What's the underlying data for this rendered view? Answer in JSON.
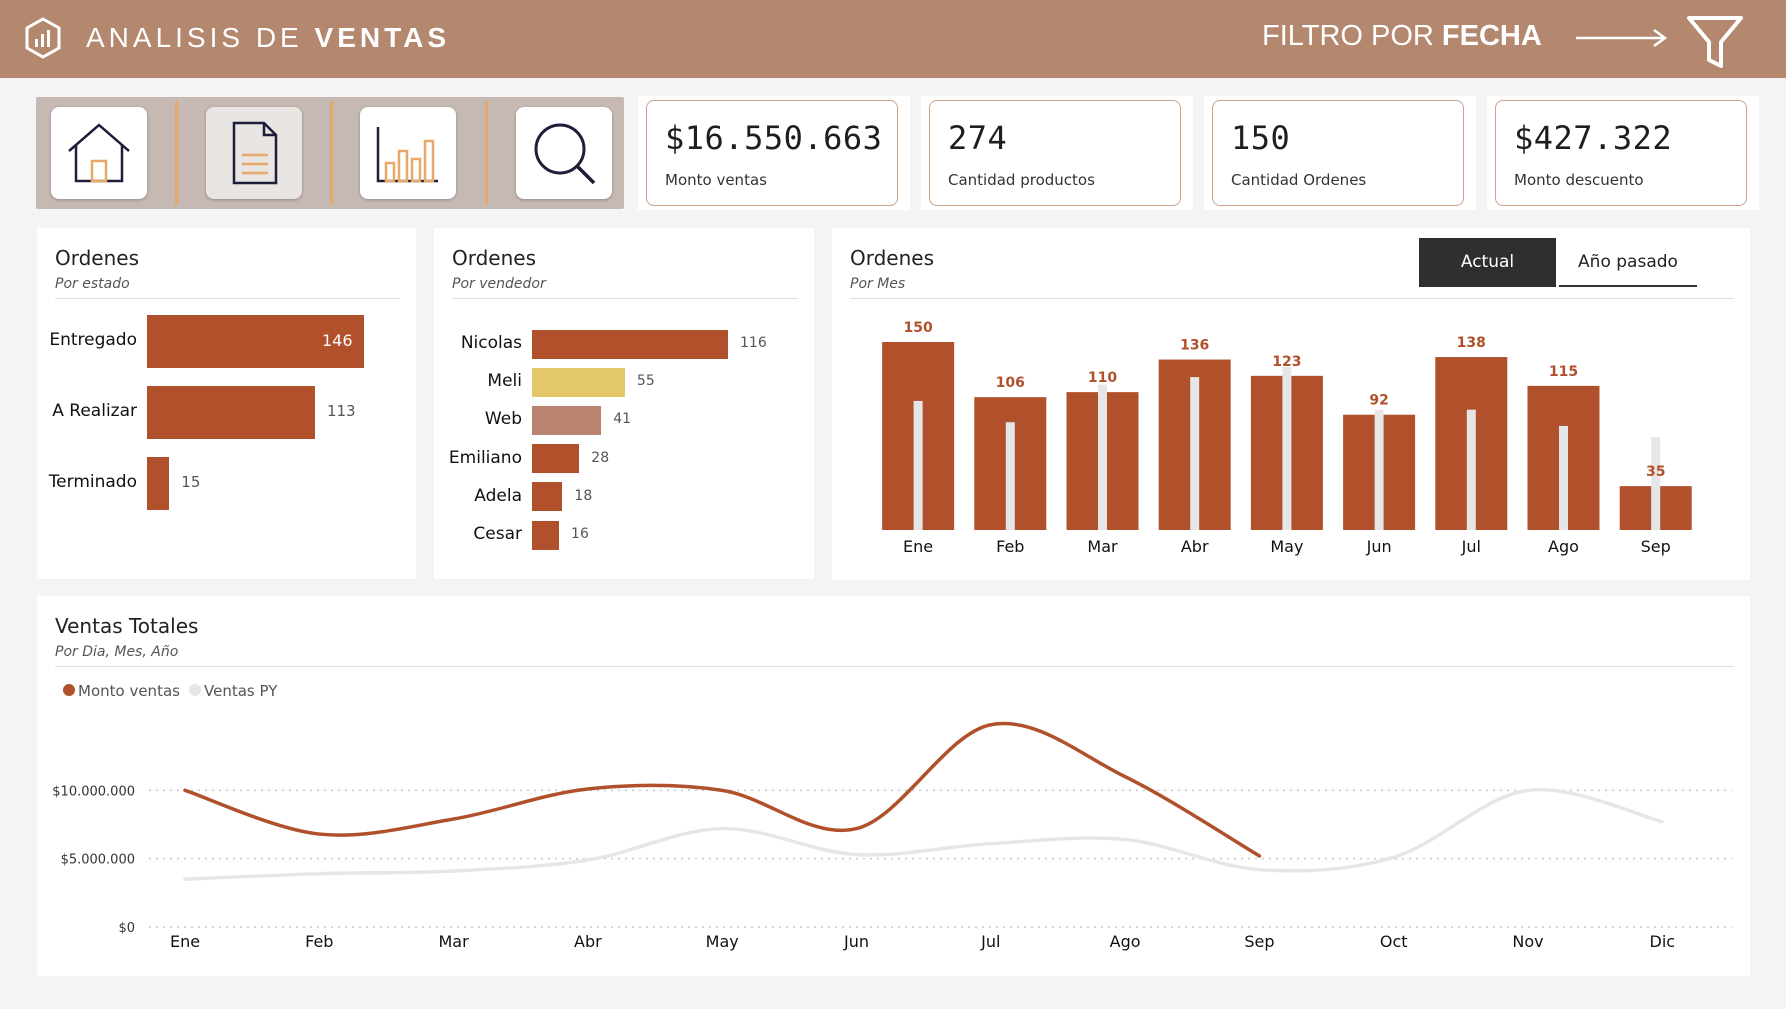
{
  "header": {
    "title_light": "ANALISIS DE ",
    "title_bold": "VENTAS",
    "filter_light": "FILTRO POR ",
    "filter_bold": "FECHA"
  },
  "nav": {
    "icons": [
      "home-icon",
      "document-icon",
      "bar-chart-icon",
      "search-icon"
    ],
    "active": "document-icon"
  },
  "kpis": [
    {
      "value": "$16.550.663",
      "label": "Monto ventas"
    },
    {
      "value": "274",
      "label": "Cantidad productos"
    },
    {
      "value": "150",
      "label": "Cantidad Ordenes"
    },
    {
      "value": "$427.322",
      "label": "Monto descuento"
    }
  ],
  "colors": {
    "accent": "#b0512c",
    "header": "#b4876f",
    "yellow": "#e3c869",
    "tan": "#b98470",
    "py": "#e6e6e6"
  },
  "estado": {
    "title": "Ordenes",
    "subtitle": "Por estado"
  },
  "vendedor": {
    "title": "Ordenes",
    "subtitle": "Por vendedor"
  },
  "mes": {
    "title": "Ordenes",
    "subtitle": "Por Mes",
    "toggle_on": "Actual",
    "toggle_off": "Año pasado"
  },
  "ventas": {
    "title": "Ventas Totales",
    "subtitle": "Por Dia, Mes, Año"
  },
  "chart_data": [
    {
      "type": "bar",
      "orientation": "horizontal",
      "categories": [
        "Entregado",
        "A Realizar",
        "Terminado"
      ],
      "values": [
        146,
        113,
        15
      ]
    },
    {
      "type": "bar",
      "orientation": "horizontal",
      "categories": [
        "Nicolas",
        "Meli",
        "Web",
        "Emiliano",
        "Adela",
        "Cesar"
      ],
      "values": [
        116,
        55,
        41,
        28,
        18,
        16
      ]
    },
    {
      "type": "bar",
      "categories": [
        "Ene",
        "Feb",
        "Mar",
        "Abr",
        "May",
        "Jun",
        "Jul",
        "Ago",
        "Sep"
      ],
      "series": [
        {
          "values": [
            150,
            106,
            110,
            136,
            123,
            92,
            138,
            115,
            35
          ]
        },
        {
          "values": [
            103,
            86,
            116,
            122,
            130,
            96,
            96,
            83,
            74
          ]
        }
      ],
      "ylim": [
        0,
        160
      ]
    },
    {
      "type": "line",
      "x": [
        "Ene",
        "Feb",
        "Mar",
        "Abr",
        "May",
        "Jun",
        "Jul",
        "Ago",
        "Sep",
        "Oct",
        "Nov",
        "Dic"
      ],
      "series": [
        {
          "name": "Monto ventas",
          "values": [
            10000000,
            6800000,
            7900000,
            10100000,
            10000000,
            7200000,
            14800000,
            11000000,
            5200000,
            null,
            null,
            null
          ]
        },
        {
          "name": "Ventas PY",
          "values": [
            3500000,
            3900000,
            4100000,
            4900000,
            7200000,
            5300000,
            6100000,
            6400000,
            4200000,
            5100000,
            10000000,
            7700000
          ]
        }
      ],
      "yticks": [
        "$10.000.000",
        "$5.000.000",
        "$0"
      ],
      "ylim": [
        0,
        15000000
      ],
      "legend": "top-left",
      "grid": true
    }
  ]
}
